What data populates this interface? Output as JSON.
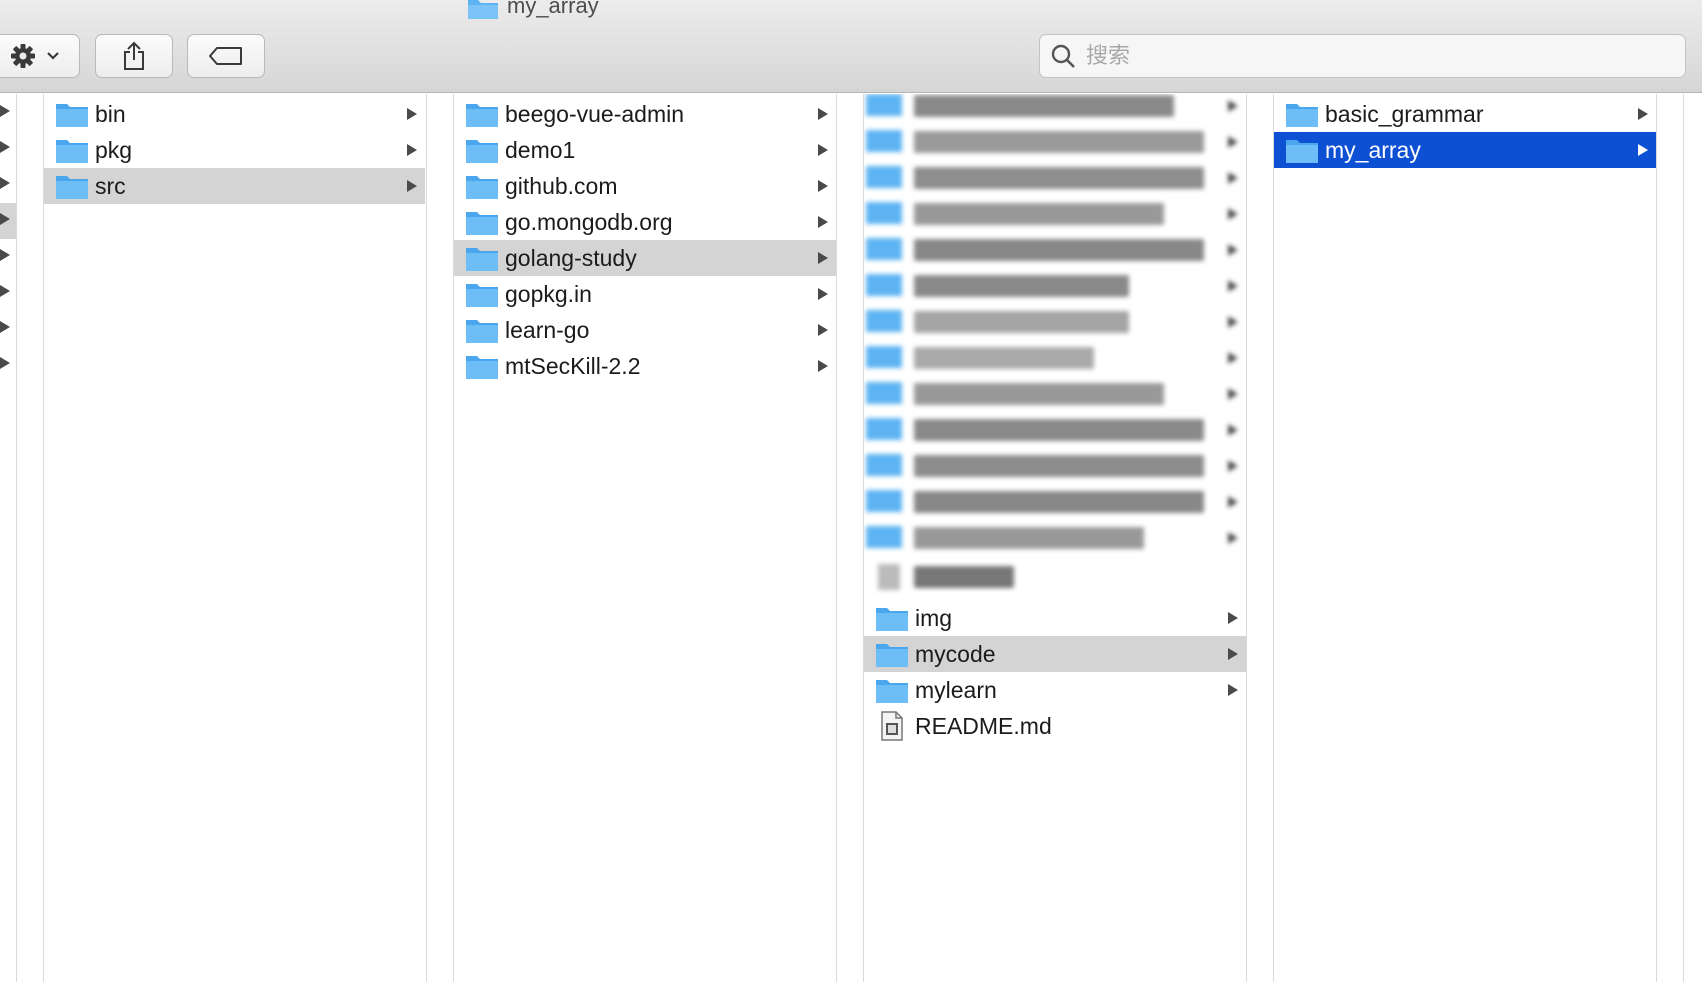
{
  "window": {
    "title": "my_array"
  },
  "toolbar": {
    "action_icon": "gear-icon",
    "action_menu_icon": "chevron-down-icon",
    "share_icon": "share-icon",
    "tag_icon": "tag-icon",
    "search_icon": "search-icon",
    "search_placeholder": "搜索",
    "search_value": ""
  },
  "columns": [
    {
      "items": [
        {
          "name": "bin",
          "type": "folder",
          "selected": false
        },
        {
          "name": "pkg",
          "type": "folder",
          "selected": false
        },
        {
          "name": "src",
          "type": "folder",
          "selected": true
        }
      ]
    },
    {
      "items": [
        {
          "name": "beego-vue-admin",
          "type": "folder",
          "selected": false
        },
        {
          "name": "demo1",
          "type": "folder",
          "selected": false
        },
        {
          "name": "github.com",
          "type": "folder",
          "selected": false
        },
        {
          "name": "go.mongodb.org",
          "type": "folder",
          "selected": false
        },
        {
          "name": "golang-study",
          "type": "folder",
          "selected": true
        },
        {
          "name": "gopkg.in",
          "type": "folder",
          "selected": false
        },
        {
          "name": "learn-go",
          "type": "folder",
          "selected": false
        },
        {
          "name": "mtSecKill-2.2",
          "type": "folder",
          "selected": false
        }
      ]
    },
    {
      "blurred_rows": 13,
      "items": [
        {
          "name": "img",
          "type": "folder",
          "selected": false
        },
        {
          "name": "mycode",
          "type": "folder",
          "selected": true
        },
        {
          "name": "mylearn",
          "type": "folder",
          "selected": false
        },
        {
          "name": "README.md",
          "type": "file",
          "selected": false
        }
      ]
    },
    {
      "items": [
        {
          "name": "basic_grammar",
          "type": "folder",
          "selected": false
        },
        {
          "name": "my_array",
          "type": "folder",
          "selected": true,
          "active": true
        }
      ]
    }
  ],
  "colors": {
    "folder": "#5eb4f3",
    "selection_active": "#0e50d4",
    "selection_inactive": "#d4d4d4"
  }
}
